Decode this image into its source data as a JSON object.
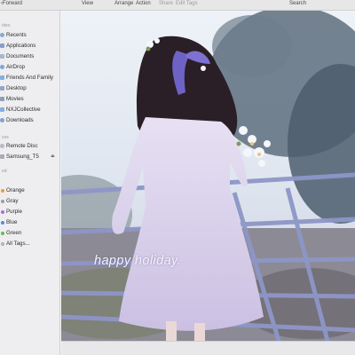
{
  "toolbar": {
    "title": "‹Forward",
    "view": "View",
    "arrange": "Arrange",
    "action": "Action",
    "share": "Share",
    "edit_tags": "Edit Tags",
    "search": "Search"
  },
  "sidebar": {
    "favorites_header": "rites",
    "favorites": [
      {
        "label": "Recents",
        "icon": "clock-icon"
      },
      {
        "label": "Applications",
        "icon": "applications-icon"
      },
      {
        "label": "Documents",
        "icon": "document-icon"
      },
      {
        "label": "AirDrop",
        "icon": "airdrop-icon"
      },
      {
        "label": "Friends And Family",
        "icon": "folder-icon"
      },
      {
        "label": "Desktop",
        "icon": "desktop-icon"
      },
      {
        "label": "Movies",
        "icon": "movies-icon"
      },
      {
        "label": "NXJCollective",
        "icon": "folder-icon"
      },
      {
        "label": "Downloads",
        "icon": "downloads-icon"
      }
    ],
    "devices_header": "ces",
    "devices": [
      {
        "label": "Remote Disc",
        "icon": "disc-icon"
      },
      {
        "label": "Samsung_T5",
        "icon": "drive-icon",
        "eject": "⏏"
      }
    ],
    "tags_header": "ed",
    "tags": [
      {
        "label": "Orange",
        "color": "#f29a36"
      },
      {
        "label": "Gray",
        "color": "#9d9d9f"
      },
      {
        "label": "Purple",
        "color": "#b36ad9"
      },
      {
        "label": "Blue",
        "color": "#4a90e2"
      },
      {
        "label": "Green",
        "color": "#5fbf4f"
      },
      {
        "label": "All Tags...",
        "color": "#c8c8ca"
      }
    ]
  },
  "photo": {
    "caption": "happy holiday."
  }
}
